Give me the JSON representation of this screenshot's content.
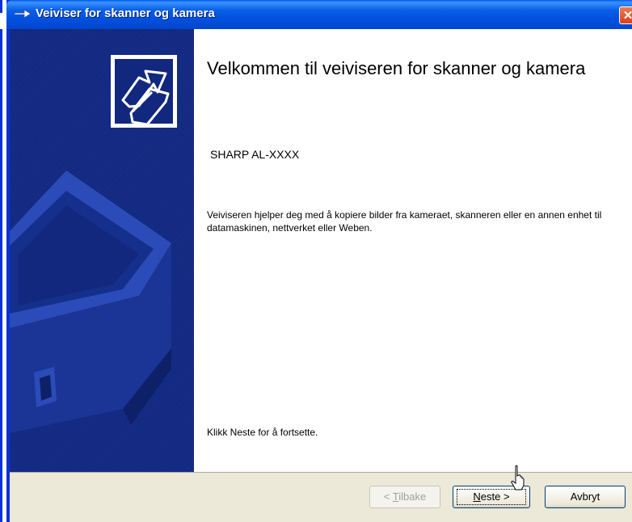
{
  "window": {
    "title": "Veiviser for skanner og kamera",
    "close_glyph": "✕",
    "icon": "wizard-arrow-icon"
  },
  "main": {
    "heading": "Velkommen til veiviseren for skanner og kamera",
    "device_name": "SHARP AL-XXXX",
    "description": "Veiviseren hjelper deg med å kopiere bilder fra kameraet, skanneren eller en annen enhet til datamaskinen, nettverket eller Weben.",
    "hint": "Klikk Neste for å fortsette."
  },
  "buttons": {
    "back_prefix": "< ",
    "back_accel": "T",
    "back_rest": "ilbake",
    "next_accel": "N",
    "next_rest": "este >",
    "cancel": "Avbryt"
  },
  "colors": {
    "titlebar": "#0058ee",
    "side_panel": "#12287e",
    "footer": "#ece9d8",
    "close_button": "#d9411f"
  }
}
